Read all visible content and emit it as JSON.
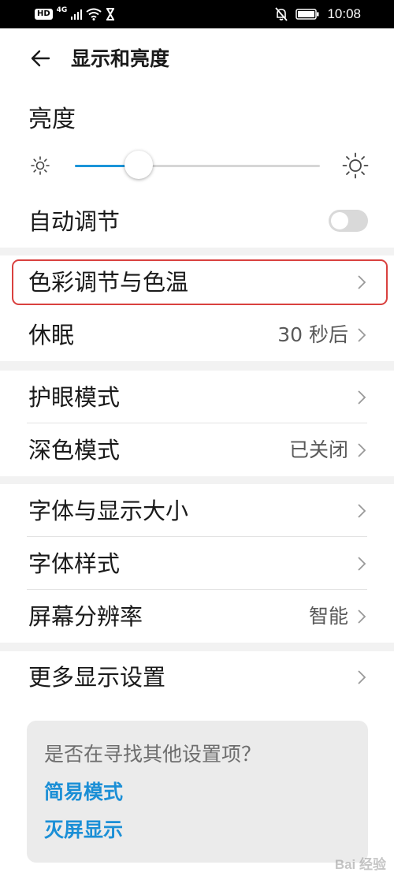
{
  "status_bar": {
    "hd_badge": "HD",
    "network": "4G",
    "time": "10:08",
    "icons": [
      "signal-icon",
      "wifi-icon",
      "hourglass-icon",
      "mute-icon",
      "battery-icon"
    ]
  },
  "header": {
    "title": "显示和亮度",
    "back_icon": "back-arrow-icon"
  },
  "brightness": {
    "section_title": "亮度",
    "level_fraction": 0.26,
    "auto_adjust_label": "自动调节",
    "auto_adjust_on": false
  },
  "settings": {
    "color_temp_label": "色彩调节与色温",
    "sleep_label": "休眠",
    "sleep_value": "30 秒后",
    "eye_comfort_label": "护眼模式",
    "dark_mode_label": "深色模式",
    "dark_mode_value": "已关闭",
    "font_display_size_label": "字体与显示大小",
    "font_style_label": "字体样式",
    "resolution_label": "屏幕分辨率",
    "resolution_value": "智能",
    "more_display_label": "更多显示设置"
  },
  "suggestions": {
    "title": "是否在寻找其他设置项？",
    "links": [
      "简易模式",
      "灭屏显示"
    ]
  },
  "watermark": "Bai 经验",
  "colors": {
    "accent": "#1b95d9",
    "link": "#1b8fd6",
    "highlight_border": "#d9413f"
  }
}
